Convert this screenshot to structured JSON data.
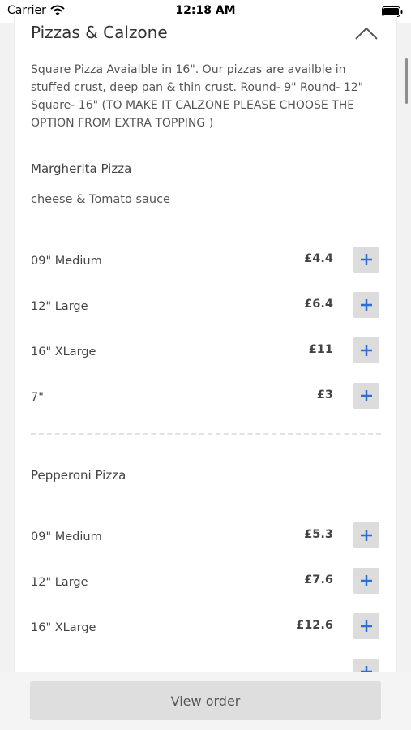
{
  "status_bar": {
    "carrier": "Carrier",
    "time": "12:18 AM"
  },
  "category": {
    "title": "Pizzas & Calzone",
    "description": "Square Pizza Avaialble in 16\". Our pizzas are availble in stuffed crust, deep pan & thin crust. Round- 9\" Round- 12\" Square- 16\" (TO MAKE IT CALZONE PLEASE CHOOSE THE OPTION FROM EXTRA TOPPING )"
  },
  "items": [
    {
      "name": "Margherita Pizza",
      "description": "cheese & Tomato sauce",
      "variants": [
        {
          "name": "09\" Medium",
          "price": "£4.4"
        },
        {
          "name": "12\" Large",
          "price": "£6.4"
        },
        {
          "name": "16\" XLarge",
          "price": "£11"
        },
        {
          "name": "7\"",
          "price": "£3"
        }
      ]
    },
    {
      "name": "Pepperoni Pizza",
      "variants": [
        {
          "name": "09\" Medium",
          "price": "£5.3"
        },
        {
          "name": "12\" Large",
          "price": "£7.6"
        },
        {
          "name": "16\" XLarge",
          "price": "£12.6"
        }
      ]
    }
  ],
  "add_icon": "plus-icon",
  "accent_color": "#2b6fd6",
  "footer": {
    "view_order_label": "View order"
  }
}
